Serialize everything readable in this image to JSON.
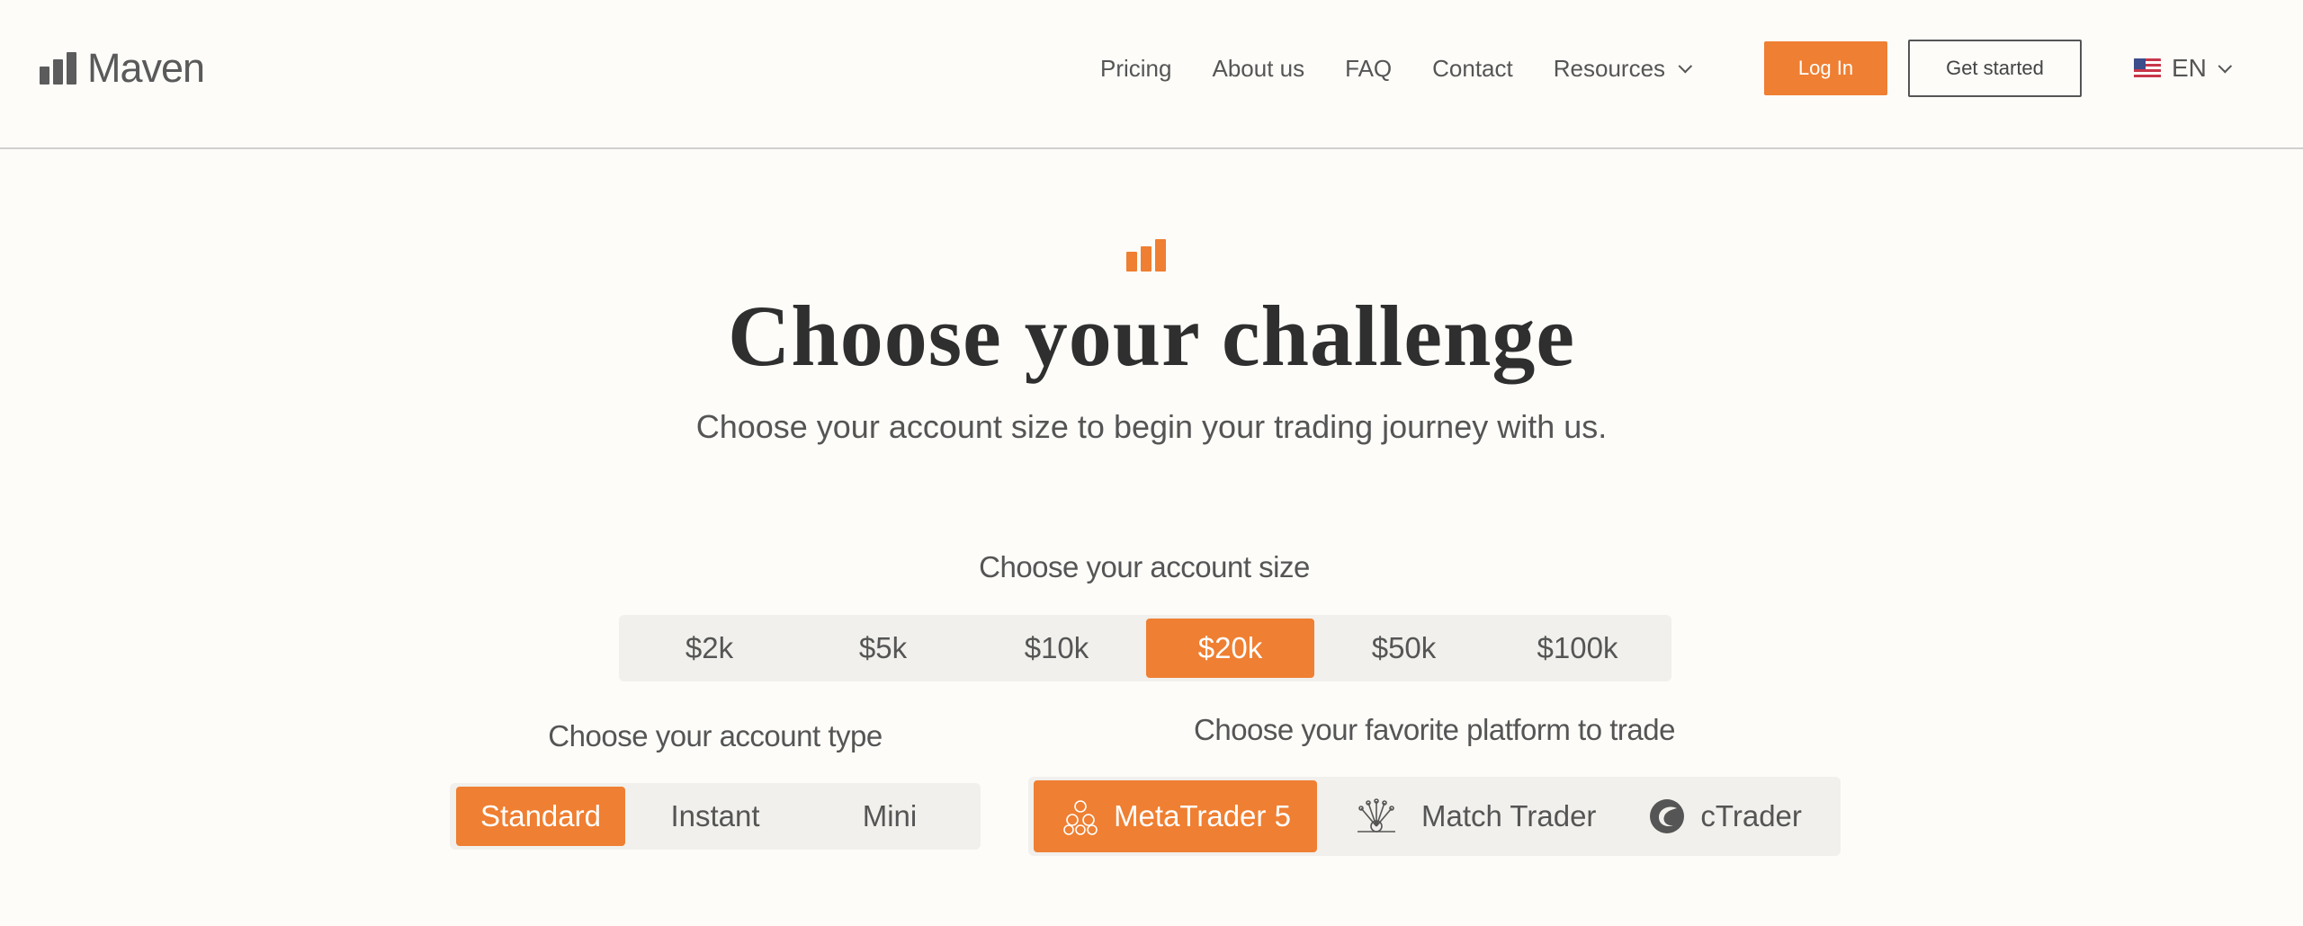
{
  "header": {
    "logo_text": "Maven",
    "nav": [
      "Pricing",
      "About us",
      "FAQ",
      "Contact",
      "Resources"
    ],
    "login_label": "Log In",
    "get_started_label": "Get started",
    "language": "EN"
  },
  "hero": {
    "title": "Choose your challenge",
    "subtitle": "Choose your account size to begin your trading journey with us."
  },
  "account_size": {
    "label": "Choose your account size",
    "options": [
      "$2k",
      "$5k",
      "$10k",
      "$20k",
      "$50k",
      "$100k"
    ],
    "selected": "$20k"
  },
  "account_type": {
    "label": "Choose your account type",
    "options": [
      "Standard",
      "Instant",
      "Mini"
    ],
    "selected": "Standard"
  },
  "platform": {
    "label": "Choose your favorite platform to trade",
    "options": [
      "MetaTrader 5",
      "Match Trader",
      "cTrader"
    ],
    "selected": "MetaTrader 5"
  },
  "colors": {
    "accent": "#ef7f32",
    "background": "#fdfcf9",
    "segment_bg": "#f1f0ec"
  }
}
